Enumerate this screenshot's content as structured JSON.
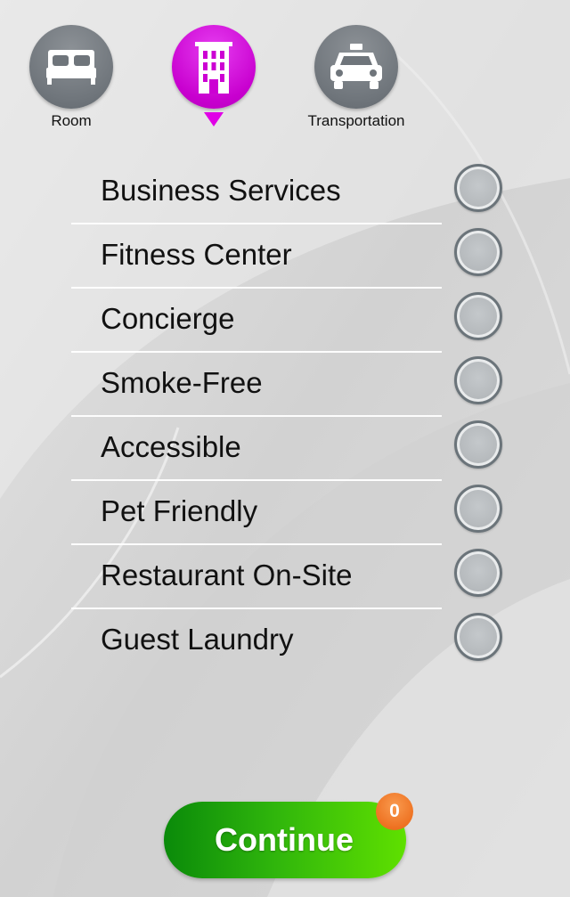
{
  "tabs": [
    {
      "label": "Room",
      "icon": "bed-icon",
      "active": false
    },
    {
      "label": "",
      "icon": "hotel-building-icon",
      "active": true
    },
    {
      "label": "Transportation",
      "icon": "taxi-icon",
      "active": false
    }
  ],
  "amenities": [
    {
      "label": "Business Services",
      "selected": false
    },
    {
      "label": "Fitness Center",
      "selected": false
    },
    {
      "label": "Concierge",
      "selected": false
    },
    {
      "label": "Smoke-Free",
      "selected": false
    },
    {
      "label": "Accessible",
      "selected": false
    },
    {
      "label": "Pet Friendly",
      "selected": false
    },
    {
      "label": "Restaurant On-Site",
      "selected": false
    },
    {
      "label": "Guest Laundry",
      "selected": false
    }
  ],
  "continue_button": {
    "label": "Continue",
    "badge_count": "0"
  },
  "colors": {
    "active_tab": "#cc00d3",
    "inactive_tab": "#6f757b",
    "continue_green": "#2fb50c",
    "badge_orange": "#ee7222"
  }
}
